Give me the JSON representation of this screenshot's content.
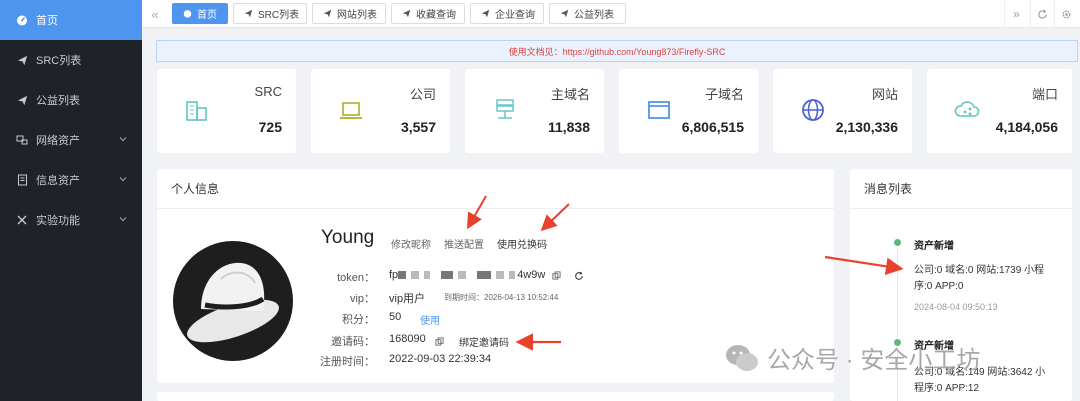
{
  "sidebar": {
    "items": [
      {
        "label": "首页",
        "icon": "dashboard-icon",
        "active": true
      },
      {
        "label": "SRC列表",
        "icon": "send-icon"
      },
      {
        "label": "公益列表",
        "icon": "send-icon"
      },
      {
        "label": "网络资产",
        "icon": "network-icon",
        "expandable": true
      },
      {
        "label": "信息资产",
        "icon": "document-icon",
        "expandable": true
      },
      {
        "label": "实验功能",
        "icon": "tools-icon",
        "expandable": true
      }
    ]
  },
  "tabs": [
    {
      "label": "首页",
      "active": true
    },
    {
      "label": "SRC列表"
    },
    {
      "label": "网站列表"
    },
    {
      "label": "收藏查询"
    },
    {
      "label": "企业查询"
    },
    {
      "label": "公益列表"
    }
  ],
  "notice": "使用文档见：https://github.com/Young873/Firefly-SRC",
  "stats": [
    {
      "label": "SRC",
      "value": "725",
      "icon": "building-icon",
      "color": "#5fc6c0"
    },
    {
      "label": "公司",
      "value": "3,557",
      "icon": "laptop-icon",
      "color": "#b5b83a"
    },
    {
      "label": "主域名",
      "value": "11,838",
      "icon": "server-icon",
      "color": "#6cc3cf"
    },
    {
      "label": "子域名",
      "value": "6,806,515",
      "icon": "browser-window-icon",
      "color": "#4e95ef"
    },
    {
      "label": "网站",
      "value": "2,130,336",
      "icon": "globe-icon",
      "color": "#4e5fd8"
    },
    {
      "label": "端口",
      "value": "4,184,056",
      "icon": "cloud-share-icon",
      "color": "#5fc6c0"
    }
  ],
  "profile": {
    "title": "个人信息",
    "username": "Young",
    "edit_nickname": "修改昵称",
    "push_config": "推送配置",
    "redeem_code": "使用兑换码",
    "token_label": "token：",
    "token_prefix": "fp",
    "token_suffix": "4w9w",
    "vip_label": "vip：",
    "vip_value": "vip用户",
    "expire_text": "到期时间：2026-04-13 10:52:44",
    "points_label": "积分：",
    "points_value": "50",
    "points_use": "使用",
    "invite_label": "邀请码：",
    "invite_value": "168090",
    "bind_invite": "绑定邀请码",
    "register_label": "注册时间：",
    "register_value": "2022-09-03 22:39:34"
  },
  "messages": {
    "title": "消息列表",
    "items": [
      {
        "title": "资产新增",
        "body": "公司:0 域名:0 网站:1739 小程序:0 APP:0",
        "time": "2024-08-04 09:50:13"
      },
      {
        "title": "资产新增",
        "body": "公司:0 域名:149 网站:3642 小程序:0 APP:12",
        "time": ""
      }
    ]
  },
  "watermark": "公众号 · 安全小工坊",
  "colors": {
    "accent": "#4e95ef",
    "sidebar_bg": "#20222a",
    "arrow": "#e8412c"
  }
}
